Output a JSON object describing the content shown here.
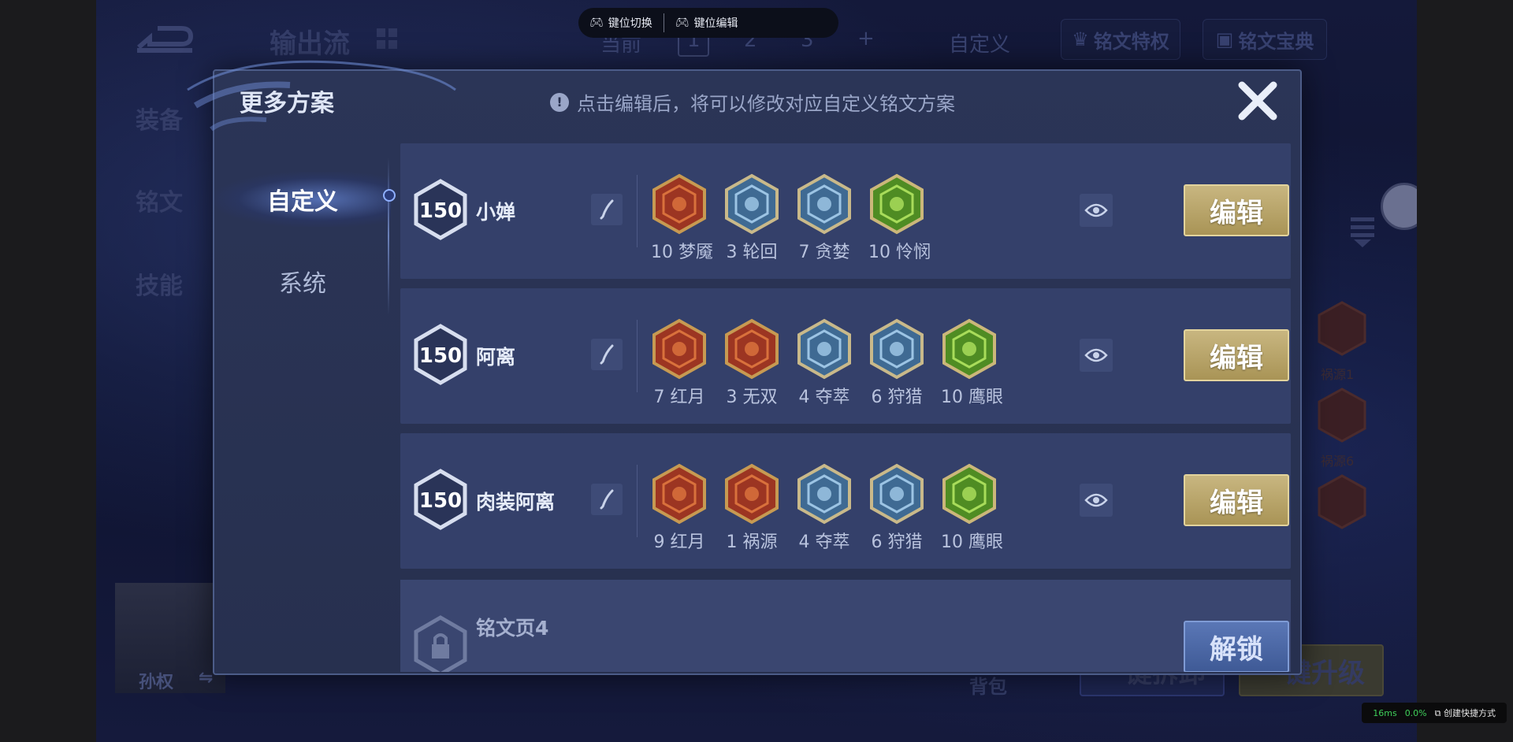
{
  "overlay": {
    "key_switch": "键位切换",
    "key_edit": "键位编辑"
  },
  "background": {
    "title": "输出流",
    "current_label": "当前",
    "tabs": [
      "1",
      "2",
      "3",
      "+"
    ],
    "custom_label": "自定义",
    "rune_privilege": "铭文特权",
    "rune_guide": "铭文宝典",
    "side_nav": [
      "装备",
      "铭文",
      "技能"
    ],
    "hero_name": "孙权",
    "bag_label": "背包",
    "rune_labels": [
      "祸源1",
      "祸源6"
    ],
    "bottom_buttons": [
      "一键拆卸",
      "一键升级"
    ]
  },
  "modal": {
    "title": "更多方案",
    "hint": "点击编辑后，将可以修改对应自定义铭文方案",
    "tabs": [
      {
        "label": "自定义",
        "active": true
      },
      {
        "label": "系统",
        "active": false
      }
    ],
    "edit_label": "编辑",
    "unlock_label": "解锁",
    "plans": [
      {
        "level": "150",
        "name": "小婵",
        "runes": [
          {
            "count": "10",
            "name": "梦魇",
            "color": "red"
          },
          {
            "count": "3",
            "name": "轮回",
            "color": "blue"
          },
          {
            "count": "7",
            "name": "贪婪",
            "color": "blue"
          },
          {
            "count": "10",
            "name": "怜悯",
            "color": "green"
          }
        ]
      },
      {
        "level": "150",
        "name": "阿离",
        "runes": [
          {
            "count": "7",
            "name": "红月",
            "color": "red"
          },
          {
            "count": "3",
            "name": "无双",
            "color": "red"
          },
          {
            "count": "4",
            "name": "夺萃",
            "color": "blue"
          },
          {
            "count": "6",
            "name": "狩猎",
            "color": "blue"
          },
          {
            "count": "10",
            "name": "鹰眼",
            "color": "green"
          }
        ]
      },
      {
        "level": "150",
        "name": "肉装阿离",
        "runes": [
          {
            "count": "9",
            "name": "红月",
            "color": "red"
          },
          {
            "count": "1",
            "name": "祸源",
            "color": "red"
          },
          {
            "count": "4",
            "name": "夺萃",
            "color": "blue"
          },
          {
            "count": "6",
            "name": "狩猎",
            "color": "blue"
          },
          {
            "count": "10",
            "name": "鹰眼",
            "color": "green"
          }
        ]
      }
    ],
    "locked_page": "铭文页4"
  },
  "perf": {
    "latency": "16ms",
    "loss": "0.0%",
    "shortcut": "创建快捷方式"
  },
  "colors": {
    "red": "#b8452c",
    "blue": "#5f8fb8",
    "green": "#6fae3a",
    "gold": "#c8b680"
  }
}
